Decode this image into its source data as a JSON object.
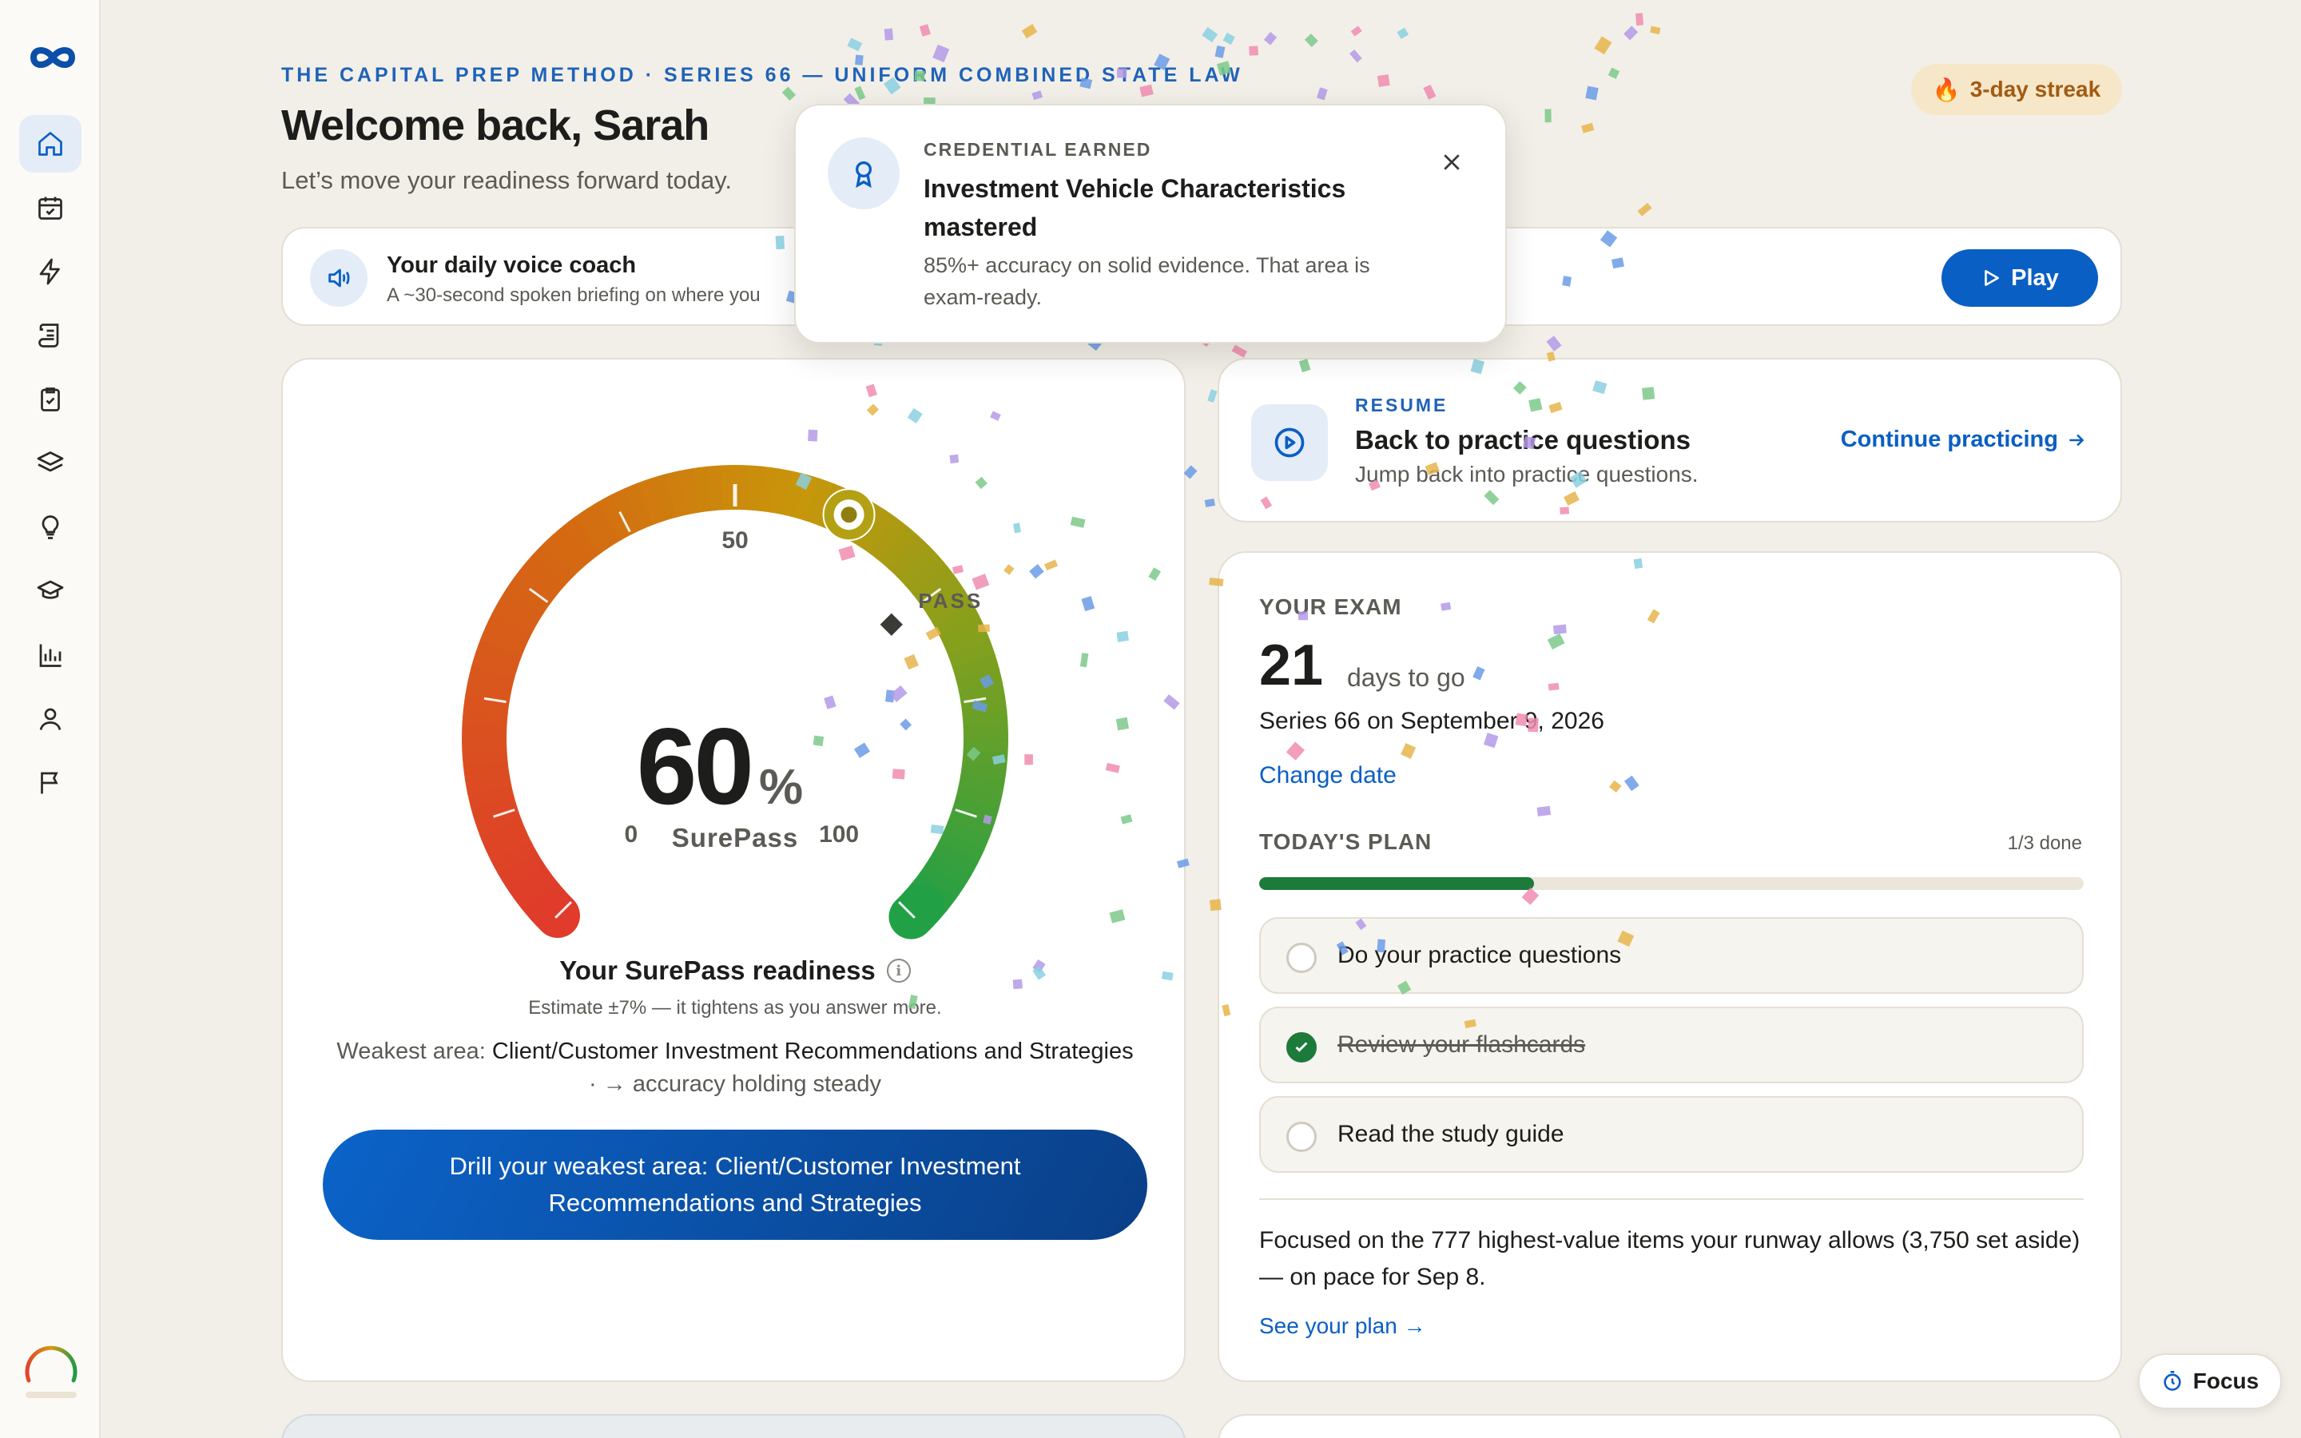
{
  "header": {
    "eyebrow": "THE CAPITAL PREP METHOD · SERIES 66 — UNIFORM COMBINED STATE LAW",
    "welcome": "Welcome back, Sarah",
    "subtitle": "Let’s move your readiness forward today.",
    "streak": "3-day streak",
    "streak_icon": "🔥"
  },
  "sidebar": {
    "items": [
      {
        "icon": "home-icon",
        "active": true
      },
      {
        "icon": "calendar-check-icon"
      },
      {
        "icon": "lightning-icon"
      },
      {
        "icon": "scroll-icon"
      },
      {
        "icon": "clipboard-check-icon"
      },
      {
        "icon": "layers-icon"
      },
      {
        "icon": "lightbulb-icon"
      },
      {
        "icon": "graduation-cap-icon"
      },
      {
        "icon": "bar-chart-icon"
      },
      {
        "icon": "user-icon"
      },
      {
        "icon": "flag-icon"
      }
    ]
  },
  "voice_coach": {
    "title": "Your daily voice coach",
    "subtitle": "A ~30-second spoken briefing on where you",
    "play_label": "Play"
  },
  "toast": {
    "eyebrow": "CREDENTIAL EARNED",
    "title": "Investment Vehicle Characteristics mastered",
    "body": "85%+ accuracy on solid evidence. That area is exam-ready."
  },
  "gauge": {
    "value": 60,
    "value_text": "60",
    "unit": "%",
    "label": "SurePass",
    "min_label": "0",
    "mid_label": "50",
    "max_label": "100",
    "pass_label": "PASS",
    "pass_value": 70,
    "readiness_title": "Your SurePass readiness",
    "estimate": "Estimate ±7% — it tightens as you answer more.",
    "weakest_prefix": "Weakest area:",
    "weakest_area": "Client/Customer Investment Recommendations and Strategies",
    "weakest_trend": "· → accuracy holding steady",
    "drill_button": "Drill your weakest area: Client/Customer Investment Recommendations and Strategies"
  },
  "resume": {
    "eyebrow": "RESUME",
    "title": "Back to practice questions",
    "subtitle": "Jump back into practice questions.",
    "link": "Continue practicing"
  },
  "exam": {
    "eyebrow": "YOUR EXAM",
    "days": "21",
    "days_label": "days to go",
    "date": "Series 66 on September 9, 2026",
    "change_date": "Change date",
    "plan_eyebrow": "TODAY'S PLAN",
    "plan_count": "1/3 done",
    "plan_progress": 0.333,
    "tasks": [
      {
        "label": "Do your practice questions",
        "done": false
      },
      {
        "label": "Review your flashcards",
        "done": true
      },
      {
        "label": "Read the study guide",
        "done": false
      }
    ],
    "focus_text": "Focused on the 777 highest-value items your runway allows (3,750 set aside) — on pace for Sep 8.",
    "see_plan": "See your plan →"
  },
  "focus_button": "Focus",
  "colors": {
    "accent": "#0a5fc4",
    "success": "#1c7a3b",
    "background": "#f2efe8"
  }
}
